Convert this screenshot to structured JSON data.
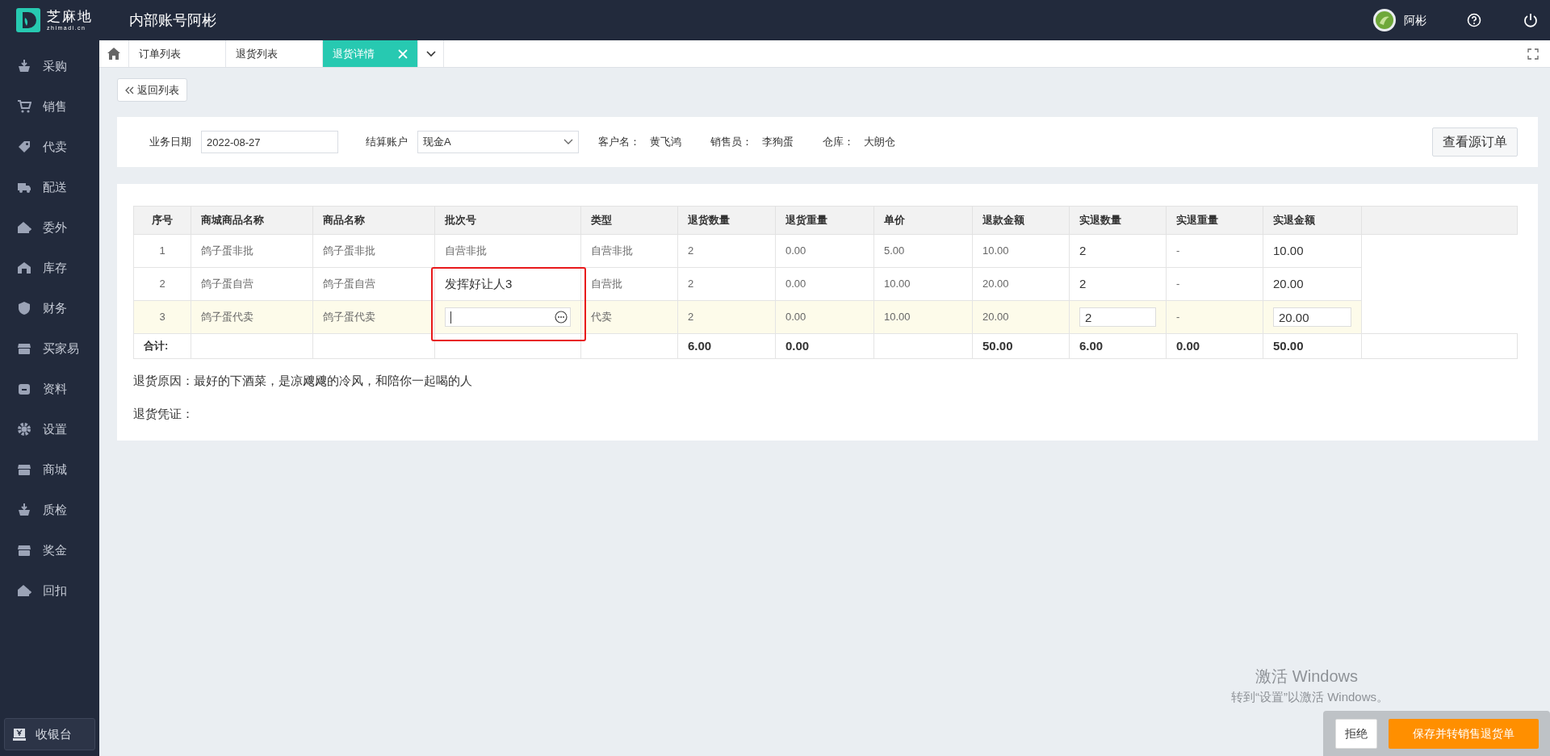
{
  "header": {
    "logo_text": "芝麻地",
    "logo_sub": "zhimadi.cn",
    "title": "内部账号阿彬",
    "user": "阿彬"
  },
  "sidebar": {
    "items": [
      {
        "label": "采购"
      },
      {
        "label": "销售"
      },
      {
        "label": "代卖"
      },
      {
        "label": "配送"
      },
      {
        "label": "委外"
      },
      {
        "label": "库存"
      },
      {
        "label": "财务"
      },
      {
        "label": "买家易"
      },
      {
        "label": "资料"
      },
      {
        "label": "设置"
      },
      {
        "label": "商城"
      },
      {
        "label": "质检"
      },
      {
        "label": "奖金"
      },
      {
        "label": "回扣"
      }
    ],
    "cashier": "收银台"
  },
  "tabs": [
    {
      "label": "订单列表",
      "selected": false
    },
    {
      "label": "退货列表",
      "selected": false
    },
    {
      "label": "退货详情",
      "selected": true
    }
  ],
  "back_button": "返回列表",
  "form": {
    "date": {
      "label": "业务日期",
      "value": "2022-08-27"
    },
    "account": {
      "label": "结算账户",
      "value": "现金A"
    },
    "info": [
      {
        "label": "客户名：",
        "value": "黄飞鸿"
      },
      {
        "label": "销售员：",
        "value": "李狗蛋"
      },
      {
        "label": "仓库：",
        "value": "大朗仓"
      }
    ],
    "source_button": "查看源订单"
  },
  "table": {
    "columns": [
      "序号",
      "商城商品名称",
      "商品名称",
      "批次号",
      "类型",
      "退货数量",
      "退货重量",
      "单价",
      "退款金额",
      "实退数量",
      "实退重量",
      "实退金额"
    ],
    "rows": [
      {
        "cells": [
          "1",
          "鸽子蛋非批",
          "鸽子蛋非批",
          "自营非批",
          "自营非批",
          "2",
          "0.00",
          "5.00",
          "10.00",
          "2",
          "-",
          "10.00"
        ],
        "editing": false
      },
      {
        "cells": [
          "2",
          "鸽子蛋自营",
          "鸽子蛋自营",
          "发挥好让人3",
          "自营批",
          "2",
          "0.00",
          "10.00",
          "20.00",
          "2",
          "-",
          "20.00"
        ],
        "editing": false
      },
      {
        "cells": [
          "3",
          "鸽子蛋代卖",
          "鸽子蛋代卖",
          null,
          "代卖",
          "2",
          "0.00",
          "10.00",
          "20.00",
          "2",
          "-",
          "20.00"
        ],
        "editing": true
      }
    ],
    "totals": {
      "label": "合计:",
      "return_qty": "6.00",
      "return_weight": "0.00",
      "refund_amount": "50.00",
      "actual_qty": "6.00",
      "actual_weight": "0.00",
      "actual_amount": "50.00"
    }
  },
  "reason": {
    "label": "退货原因：",
    "text": "最好的下酒菜，是凉飕飕的冷风，和陪你一起喝的人"
  },
  "voucher": {
    "label": "退货凭证："
  },
  "os_notice": {
    "title": "激活 Windows",
    "text": "转到“设置”以激活 Windows。"
  },
  "footer": {
    "reject_button": "拒绝",
    "save_button": "保存并转销售退货单"
  }
}
